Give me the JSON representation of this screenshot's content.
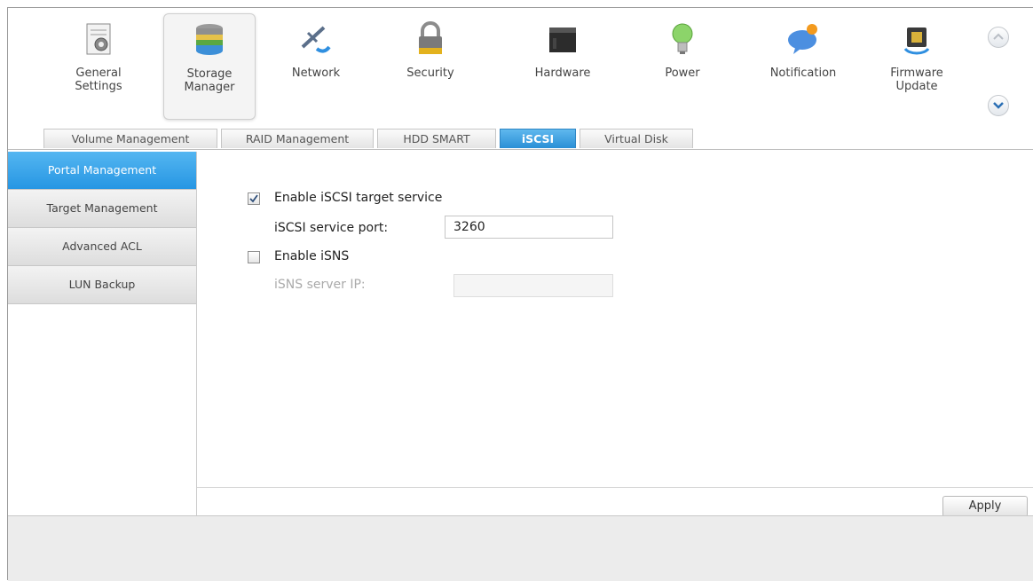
{
  "toolbar": {
    "items": [
      {
        "label": "General\nSettings",
        "icon": "general-settings-icon"
      },
      {
        "label": "Storage\nManager",
        "icon": "storage-manager-icon"
      },
      {
        "label": "Network",
        "icon": "network-icon"
      },
      {
        "label": "Security",
        "icon": "lock-icon"
      },
      {
        "label": "Hardware",
        "icon": "hardware-icon"
      },
      {
        "label": "Power",
        "icon": "power-bulb-icon"
      },
      {
        "label": "Notification",
        "icon": "notification-icon"
      },
      {
        "label": "Firmware\nUpdate",
        "icon": "firmware-update-icon"
      }
    ],
    "selected_index": 1
  },
  "tabs": [
    "Volume Management",
    "RAID Management",
    "HDD SMART",
    "iSCSI",
    "Virtual Disk"
  ],
  "active_tab": "iSCSI",
  "sidebar": {
    "items": [
      "Portal Management",
      "Target Management",
      "Advanced ACL",
      "LUN Backup"
    ],
    "active": "Portal Management"
  },
  "form": {
    "enable_iscsi_label": "Enable iSCSI target service",
    "enable_iscsi_checked": true,
    "service_port_label": "iSCSI service port:",
    "service_port_value": "3260",
    "enable_isns_label": "Enable iSNS",
    "enable_isns_checked": false,
    "isns_ip_label": "iSNS server IP:",
    "isns_ip_value": ""
  },
  "apply_label": "Apply",
  "colors": {
    "accent": "#2a8fd6",
    "sidebar_active": "#3aa6ec"
  }
}
